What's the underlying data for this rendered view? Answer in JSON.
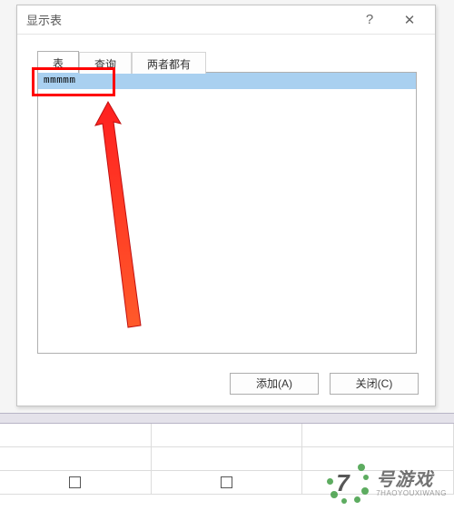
{
  "dialog": {
    "title": "显示表",
    "help": "?",
    "close": "✕"
  },
  "tabs": {
    "t1": "表",
    "t2": "查询",
    "t3": "两者都有"
  },
  "list": {
    "item1": "mmmmm"
  },
  "buttons": {
    "add": "添加(A)",
    "close": "关闭(C)"
  },
  "watermark": {
    "num": "7",
    "cn": "号游戏",
    "py": "7HAOYOUXIWANG"
  }
}
